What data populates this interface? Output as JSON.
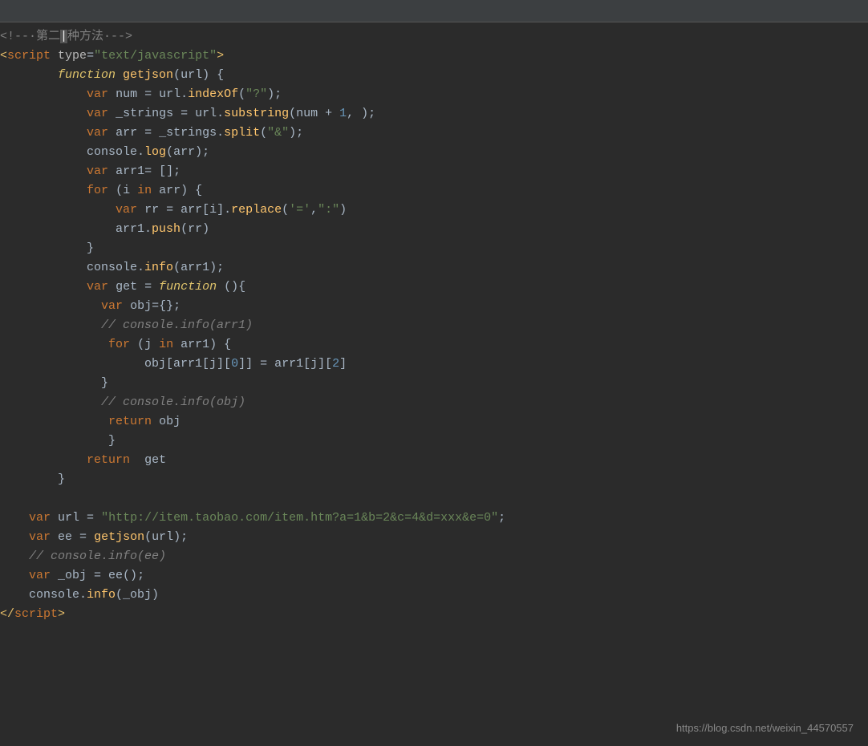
{
  "header": {
    "text": "<!-- 第二种方法 -->"
  },
  "watermark": "https://blog.csdn.net/weixin_44570557",
  "lines": [
    {
      "num": "",
      "html": "<span class='html-comment'>&lt;!--·第二<span style='background:#555;color:#eee;'>|</span>种方法·--&gt;</span>"
    },
    {
      "num": "",
      "html": "<span class='tag'>&lt;<span class='tag-close'>script</span></span> <span class='attr'>type</span><span class='punct'>=</span><span class='attrv'>\"text/javascript\"</span><span class='tag'>&gt;</span>"
    },
    {
      "num": "",
      "html": "        <span class='kw2'>function</span> <span class='fn'>getjson</span><span class='plain'>(url) {</span>"
    },
    {
      "num": "",
      "html": "            <span class='kw'>var</span> <span class='plain'>num = url.</span><span class='method'>indexOf</span><span class='plain'>(</span><span class='str'>\"?\"</span><span class='plain'>);</span>"
    },
    {
      "num": "",
      "html": "            <span class='kw'>var</span> <span class='plain'>_strings = url.</span><span class='method'>substring</span><span class='plain'>(num + </span><span class='num'>1</span><span class='plain'>, );</span>"
    },
    {
      "num": "",
      "html": "            <span class='kw'>var</span> <span class='plain'>arr = _strings.</span><span class='method'>split</span><span class='plain'>(</span><span class='str'>\"&amp;\"</span><span class='plain'>);</span>"
    },
    {
      "num": "",
      "html": "            <span class='plain'>console.</span><span class='method'>log</span><span class='plain'>(arr);</span>"
    },
    {
      "num": "",
      "html": "            <span class='kw'>var</span> <span class='plain'>arr1= [];</span>"
    },
    {
      "num": "",
      "html": "            <span class='kw'>for</span> <span class='plain'>(i </span><span class='kw'>in</span><span class='plain'> arr) {</span>"
    },
    {
      "num": "",
      "html": "                <span class='kw'>var</span> <span class='plain'>rr = arr[i].</span><span class='method'>replace</span><span class='plain'>(</span><span class='str'>'='</span><span class='plain'>,</span><span class='str'>\":\"</span><span class='plain'>)</span>"
    },
    {
      "num": "",
      "html": "                <span class='plain'>arr1.</span><span class='method'>push</span><span class='plain'>(rr)</span>"
    },
    {
      "num": "",
      "html": "            <span class='plain'>}</span>"
    },
    {
      "num": "",
      "html": "            <span class='plain'>console.</span><span class='method'>info</span><span class='plain'>(arr1);</span>"
    },
    {
      "num": "",
      "html": "            <span class='kw'>var</span> <span class='plain'>get = </span><span class='kw2'>function</span><span class='plain'> (){</span>"
    },
    {
      "num": "",
      "html": "              <span class='kw'>var</span> <span class='plain'>obj={};</span>"
    },
    {
      "num": "",
      "html": "              <span class='cmt'>// console.info(arr1)</span>"
    },
    {
      "num": "",
      "html": "               <span class='kw'>for</span> <span class='plain'>(j </span><span class='kw'>in</span><span class='plain'> arr1) {</span>"
    },
    {
      "num": "",
      "html": "                    <span class='plain'>obj[arr1[j][</span><span class='num'>0</span><span class='plain'>]] = arr1[j][</span><span class='num'>2</span><span class='plain'>]</span>"
    },
    {
      "num": "",
      "html": "              <span class='plain'>}</span>"
    },
    {
      "num": "",
      "html": "              <span class='cmt'>// console.info(obj)</span>"
    },
    {
      "num": "",
      "html": "               <span class='kw'>return</span> <span class='plain'>obj</span>"
    },
    {
      "num": "",
      "html": "               <span class='plain'>}</span>"
    },
    {
      "num": "",
      "html": "            <span class='kw'>return</span>  <span class='plain'>get</span>"
    },
    {
      "num": "",
      "html": "        <span class='plain'>}</span>"
    },
    {
      "num": "",
      "html": ""
    },
    {
      "num": "",
      "html": "    <span class='kw'>var</span> <span class='plain'>url = </span><span class='str'>\"http://item.taobao.com/item.htm?a=1&amp;b=2&amp;c=4&amp;d=xxx&amp;e=0\"</span><span class='plain'>;</span>"
    },
    {
      "num": "",
      "html": "    <span class='kw'>var</span> <span class='plain'>ee = </span><span class='fn'>getjson</span><span class='plain'>(url);</span>"
    },
    {
      "num": "",
      "html": "    <span class='cmt'>// console.info(ee)</span>"
    },
    {
      "num": "",
      "html": "    <span class='kw'>var</span> <span class='plain'>_obj = ee();</span>"
    },
    {
      "num": "",
      "html": "    <span class='plain'>console.</span><span class='method'>info</span><span class='plain'>(_obj)</span>"
    },
    {
      "num": "",
      "html": "<span class='tag'>&lt;/</span><span class='tag-close'>script</span><span class='tag'>&gt;</span>"
    }
  ]
}
